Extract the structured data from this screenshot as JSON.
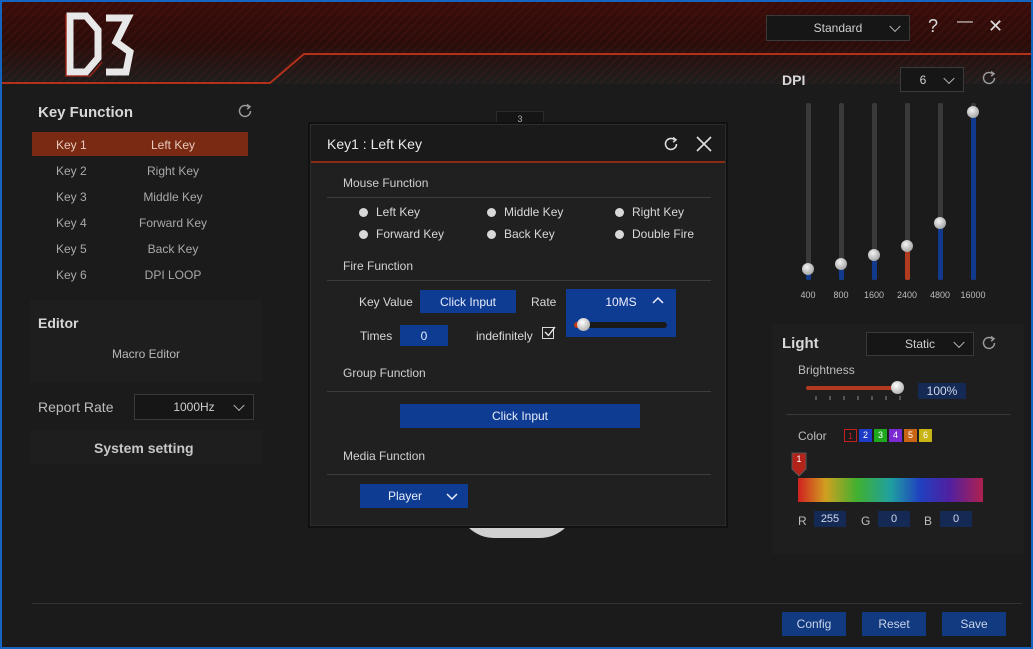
{
  "header": {
    "logo_text": "D3",
    "profile_select": "Standard",
    "help_label": "?",
    "minimize_label": "—",
    "close_label": "✕"
  },
  "key_function": {
    "title": "Key Function",
    "keys": [
      {
        "key": "Key 1",
        "function": "Left Key"
      },
      {
        "key": "Key 2",
        "function": "Right Key"
      },
      {
        "key": "Key 3",
        "function": "Middle Key"
      },
      {
        "key": "Key 4",
        "function": "Forward Key"
      },
      {
        "key": "Key 5",
        "function": "Back Key"
      },
      {
        "key": "Key 6",
        "function": "DPI LOOP"
      }
    ],
    "selected_index": 0
  },
  "editor": {
    "title": "Editor",
    "macro_label": "Macro Editor"
  },
  "report_rate": {
    "label": "Report Rate",
    "value": "1000Hz"
  },
  "system_setting_label": "System setting",
  "background_number": "3",
  "dialog": {
    "title": "Key1 : Left Key",
    "mouse_function": {
      "title": "Mouse Function",
      "options": [
        "Left Key",
        "Middle Key",
        "Right Key",
        "Forward Key",
        "Back Key",
        "Double Fire"
      ]
    },
    "fire_function": {
      "title": "Fire Function",
      "key_value_label": "Key Value",
      "key_value_button": "Click Input",
      "rate_label": "Rate",
      "rate_value": "10MS",
      "rate_level": 0.1,
      "times_label": "Times",
      "times_value": "0",
      "indefinitely_label": "indefinitely",
      "indefinitely_checked": true
    },
    "group_function": {
      "title": "Group Function",
      "button": "Click Input"
    },
    "media_function": {
      "title": "Media Function",
      "select": "Player"
    }
  },
  "dpi": {
    "title": "DPI",
    "count": "6",
    "levels": [
      {
        "label": "400",
        "level": 0.06,
        "color": "#123a8c"
      },
      {
        "label": "800",
        "level": 0.09,
        "color": "#123a8c"
      },
      {
        "label": "1600",
        "level": 0.14,
        "color": "#123a8c"
      },
      {
        "label": "2400",
        "level": 0.19,
        "color": "#b23a1e"
      },
      {
        "label": "4800",
        "level": 0.32,
        "color": "#123a8c"
      },
      {
        "label": "16000",
        "level": 0.95,
        "color": "#123a8c"
      }
    ]
  },
  "light": {
    "title": "Light",
    "mode": "Static",
    "brightness_label": "Brightness",
    "brightness_value": "100%",
    "brightness_level": 0.95,
    "color_label": "Color",
    "swatches": [
      {
        "label": "1",
        "color": "#c81e1e"
      },
      {
        "label": "2",
        "color": "#1e3cc8"
      },
      {
        "label": "3",
        "color": "#1ea81e"
      },
      {
        "label": "4",
        "color": "#7a2ad0"
      },
      {
        "label": "5",
        "color": "#c86414"
      },
      {
        "label": "6",
        "color": "#c8b414"
      }
    ],
    "marker_label": "1",
    "r_label": "R",
    "r_value": "255",
    "g_label": "G",
    "g_value": "0",
    "b_label": "B",
    "b_value": "0"
  },
  "footer": {
    "config": "Config",
    "reset": "Reset",
    "save": "Save"
  }
}
